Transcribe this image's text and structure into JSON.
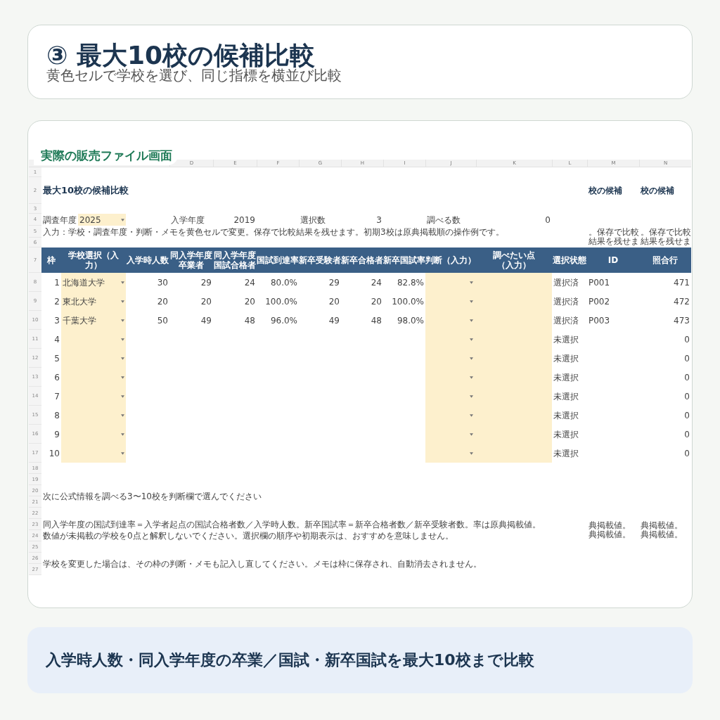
{
  "header": {
    "title": "③ 最大10校の候補比較",
    "subtitle": "黄色セルで学校を選び、同じ指標を横並び比較"
  },
  "screenshot_label": "実際の販売ファイル画面",
  "sheet": {
    "column_letters": [
      "D",
      "E",
      "F",
      "G",
      "H",
      "I",
      "J",
      "K",
      "L",
      "M",
      "N"
    ],
    "row_numbers": [
      "1",
      "2",
      "3",
      "4",
      "5",
      "6",
      "7",
      "8",
      "9",
      "10",
      "11",
      "12",
      "13",
      "14",
      "15",
      "16",
      "17",
      "18",
      "19",
      "20",
      "21",
      "22",
      "23",
      "24",
      "25",
      "26",
      "27"
    ],
    "title": "最大10校の候補比較",
    "overflow_titles": [
      "校の候補",
      "校の候補"
    ],
    "params": [
      {
        "label": "調査年度",
        "value": "2025",
        "kind": "dropdown"
      },
      {
        "label": "入学年度",
        "value": "2019",
        "kind": "plain"
      },
      {
        "label": "選択数",
        "value": "3",
        "kind": "plain"
      },
      {
        "label": "調べる数",
        "value": "0",
        "kind": "plain"
      }
    ],
    "input_note": "入力：学校・調査年度・判断・メモを黄色セルで変更。保存で比較結果を残せます。初期3校は原典掲載順の操作例です。",
    "overflow_notes": [
      "。保存で比較結果を残せま",
      "。保存で比較結果を残せま"
    ],
    "columns": [
      "枠",
      "学校選択（入力）",
      "入学時人数",
      "同入学年度卒業者",
      "同入学年度国試合格者",
      "国試到達率",
      "新卒受験者",
      "新卒合格者",
      "新卒国試率",
      "判断（入力）",
      "調べたい点（入力）",
      "選択状態",
      "ID",
      "照合行"
    ],
    "rows": [
      {
        "slot": "1",
        "school": "北海道大学",
        "values": [
          "30",
          "29",
          "24",
          "80.0%",
          "29",
          "24",
          "82.8%"
        ],
        "status": "選択済",
        "id": "P001",
        "match_row": "471"
      },
      {
        "slot": "2",
        "school": "東北大学",
        "values": [
          "20",
          "20",
          "20",
          "100.0%",
          "20",
          "20",
          "100.0%"
        ],
        "status": "選択済",
        "id": "P002",
        "match_row": "472"
      },
      {
        "slot": "3",
        "school": "千葉大学",
        "values": [
          "50",
          "49",
          "48",
          "96.0%",
          "49",
          "48",
          "98.0%"
        ],
        "status": "選択済",
        "id": "P003",
        "match_row": "473"
      },
      {
        "slot": "4",
        "status": "未選択",
        "match_row": "0"
      },
      {
        "slot": "5",
        "status": "未選択",
        "match_row": "0"
      },
      {
        "slot": "6",
        "status": "未選択",
        "match_row": "0"
      },
      {
        "slot": "7",
        "status": "未選択",
        "match_row": "0"
      },
      {
        "slot": "8",
        "status": "未選択",
        "match_row": "0"
      },
      {
        "slot": "9",
        "status": "未選択",
        "match_row": "0"
      },
      {
        "slot": "10",
        "status": "未選択",
        "match_row": "0"
      }
    ],
    "notes": [
      "次に公式情報を調べる3〜10校を判断欄で選んでください",
      "同入学年度の国試到達率＝入学者起点の国試合格者数／入学時人数。新卒国試率＝新卒合格者数／新卒受験者数。率は原典掲載値。",
      "数値が未掲載の学校を0点と解釈しないでください。選択欄の順序や初期表示は、おすすめを意味しません。",
      "学校を変更した場合は、その枠の判断・メモも記入し直してください。メモは枠に保存され、自動消去されません。"
    ],
    "overflow_footnotes": [
      "典掲載値。典掲載値。",
      "典掲載値。典掲載値。"
    ]
  },
  "footer": "入学時人数・同入学年度の卒業／国試・新卒国試を最大10校まで比較"
}
